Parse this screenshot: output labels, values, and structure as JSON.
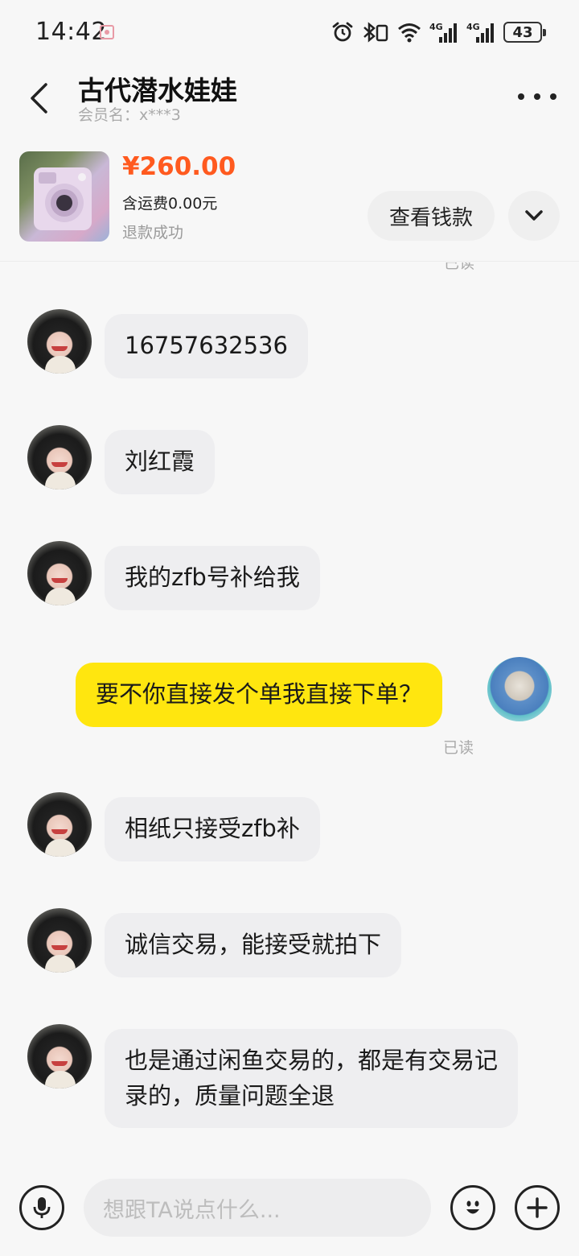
{
  "status_bar": {
    "time": "14:42",
    "battery": "43",
    "network_1": "4G",
    "network_2": "4G"
  },
  "header": {
    "title": "古代潜水娃娃",
    "member_name": "会员名：x***3"
  },
  "product": {
    "price": "¥260.00",
    "shipping": "含运费0.00元",
    "status": "退款成功",
    "view_payment_label": "查看钱款"
  },
  "messages": {
    "read_top": "已读",
    "items": [
      {
        "sender": "other",
        "text": "16757632536"
      },
      {
        "sender": "other",
        "text": "刘红霞"
      },
      {
        "sender": "other",
        "text": "我的zfb号补给我"
      },
      {
        "sender": "self",
        "text": "要不你直接发个单我直接下单？",
        "read": "已读"
      },
      {
        "sender": "other",
        "text": "相纸只接受zfb补"
      },
      {
        "sender": "other",
        "text": "诚信交易，能接受就拍下"
      },
      {
        "sender": "other",
        "text": "也是通过闲鱼交易的，都是有交易记录的，质量问题全退"
      }
    ]
  },
  "input": {
    "placeholder": "想跟TA说点什么..."
  },
  "colors": {
    "accent_yellow": "#ffe60f",
    "price_orange": "#ff5a1f",
    "bubble_gray": "#eeeef0"
  }
}
